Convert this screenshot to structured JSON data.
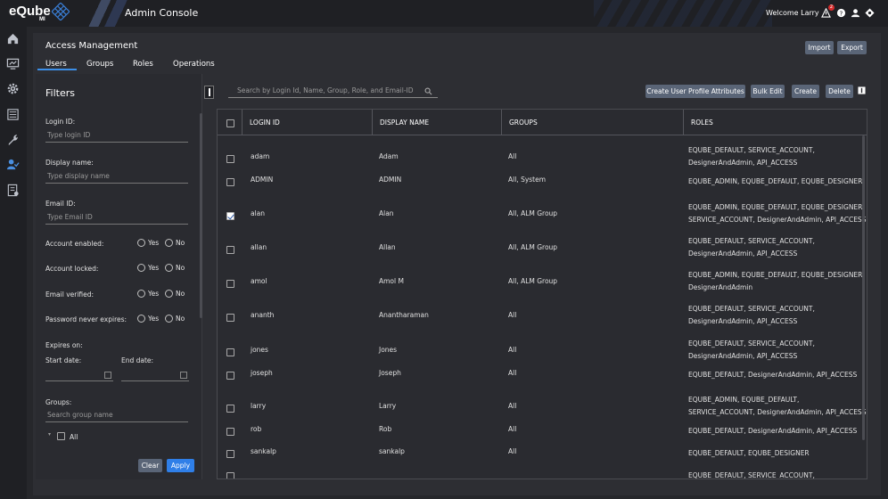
{
  "header": {
    "logo_text": "eQube",
    "logo_sub": "MI",
    "app_title": "Admin Console",
    "welcome": "Welcome Larry",
    "alert_count": "2"
  },
  "nav": {
    "icons": [
      "home-icon",
      "monitor-icon",
      "gear-icon",
      "list-icon",
      "wrench-icon",
      "user-check-icon",
      "report-icon"
    ]
  },
  "page": {
    "title": "Access Management",
    "tabs": [
      {
        "label": "Users",
        "active": true
      },
      {
        "label": "Groups"
      },
      {
        "label": "Roles"
      },
      {
        "label": "Operations"
      }
    ],
    "import_label": "Import",
    "export_label": "Export"
  },
  "filters": {
    "title": "Filters",
    "login_label": "Login ID:",
    "login_placeholder": "Type login ID",
    "display_label": "Display name:",
    "display_placeholder": "Type display name",
    "email_label": "Email ID:",
    "email_placeholder": "Type Email ID",
    "account_enabled": "Account enabled:",
    "account_locked": "Account locked:",
    "email_verified": "Email verified:",
    "pwd_never_expires": "Password never expires:",
    "yes": "Yes",
    "no": "No",
    "expires_on": "Expires on:",
    "start_date": "Start date:",
    "end_date": "End date:",
    "groups_label": "Groups:",
    "groups_placeholder": "Search group name",
    "group_all": "All",
    "clear_label": "Clear",
    "apply_label": "Apply"
  },
  "toolbar": {
    "search_placeholder": "Search by Login Id, Name, Group, Role, and Email-ID",
    "create_attrs": "Create User Profile Attributes",
    "bulk_edit": "Bulk Edit",
    "create": "Create",
    "delete": "Delete"
  },
  "table": {
    "columns": [
      "LOGIN ID",
      "DISPLAY NAME",
      "GROUPS",
      "ROLES"
    ],
    "rows": [
      {
        "login": "adam",
        "name": "Adam",
        "groups": "All",
        "roles1": "EQUBE_DEFAULT, SERVICE_ACCOUNT,",
        "roles2": "DesignerAndAdmin, API_ACCESS",
        "checked": false
      },
      {
        "login": "ADMIN",
        "name": "ADMIN",
        "groups": "All, System",
        "roles1": "EQUBE_ADMIN, EQUBE_DEFAULT, EQUBE_DESIGNER",
        "roles2": "",
        "checked": false
      },
      {
        "login": "alan",
        "name": "Alan",
        "groups": "All, ALM Group",
        "roles1": "EQUBE_ADMIN, EQUBE_DEFAULT, EQUBE_DESIGNER,",
        "roles2": "SERVICE_ACCOUNT, DesignerAndAdmin, API_ACCESS",
        "checked": true
      },
      {
        "login": "allan",
        "name": "Allan",
        "groups": "All, ALM Group",
        "roles1": "EQUBE_DEFAULT, SERVICE_ACCOUNT,",
        "roles2": "DesignerAndAdmin, API_ACCESS",
        "checked": false
      },
      {
        "login": "amol",
        "name": "Amol M",
        "groups": "All, ALM Group",
        "roles1": "EQUBE_ADMIN, EQUBE_DEFAULT, EQUBE_DESIGNER,",
        "roles2": "DesignerAndAdmin",
        "checked": false
      },
      {
        "login": "ananth",
        "name": "Anantharaman",
        "groups": "All",
        "roles1": "EQUBE_DEFAULT, SERVICE_ACCOUNT,",
        "roles2": "DesignerAndAdmin, API_ACCESS",
        "checked": false
      },
      {
        "login": "jones",
        "name": "Jones",
        "groups": "All",
        "roles1": "EQUBE_DEFAULT, SERVICE_ACCOUNT,",
        "roles2": "DesignerAndAdmin, API_ACCESS",
        "checked": false
      },
      {
        "login": "joseph",
        "name": "Joseph",
        "groups": "All",
        "roles1": "EQUBE_DEFAULT, DesignerAndAdmin, API_ACCESS",
        "roles2": "",
        "checked": false
      },
      {
        "login": "larry",
        "name": "Larry",
        "groups": "All",
        "roles1": "EQUBE_ADMIN, EQUBE_DEFAULT,",
        "roles2": "SERVICE_ACCOUNT, DesignerAndAdmin, API_ACCESS",
        "checked": false
      },
      {
        "login": "rob",
        "name": "Rob",
        "groups": "All",
        "roles1": "EQUBE_DEFAULT, DesignerAndAdmin, API_ACCESS",
        "roles2": "",
        "checked": false
      },
      {
        "login": "sankalp",
        "name": "sankalp",
        "groups": "All",
        "roles1": "EQUBE_DEFAULT, EQUBE_DESIGNER",
        "roles2": "",
        "checked": false
      },
      {
        "login": "",
        "name": "",
        "groups": "",
        "roles1": "EQUBE_DEFAULT, SERVICE_ACCOUNT,",
        "roles2": "",
        "checked": false
      }
    ]
  }
}
